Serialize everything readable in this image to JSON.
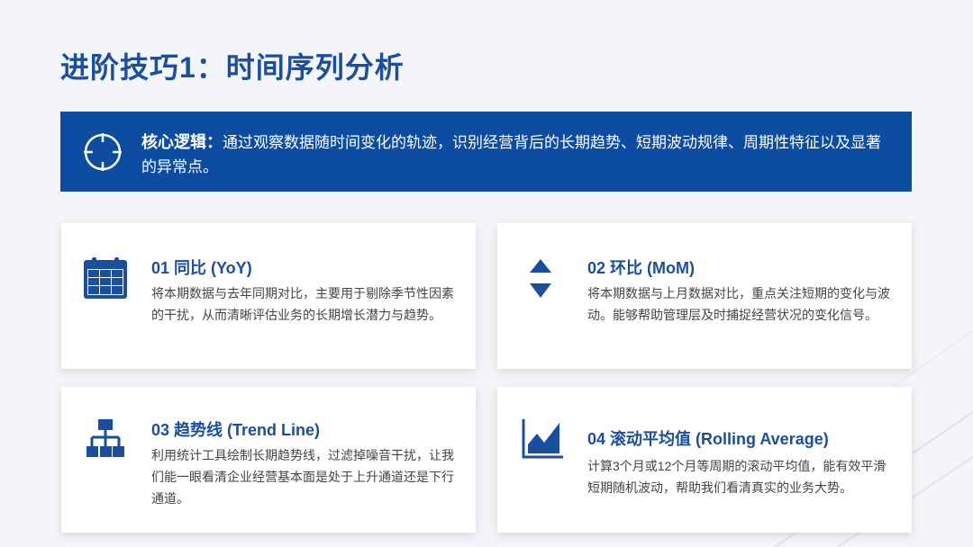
{
  "slide": {
    "title": "进阶技巧1：时间序列分析",
    "banner": {
      "label": "核心逻辑：",
      "text": "通过观察数据随时间变化的轨迹，识别经营背后的长期趋势、短期波动规律、周期性特征以及显著的异常点。"
    },
    "cards": [
      {
        "title": "01 同比 (YoY)",
        "desc": "将本期数据与去年同期对比，主要用于剔除季节性因素的干扰，从而清晰评估业务的长期增长潜力与趋势。",
        "icon": "calendar-icon"
      },
      {
        "title": "02 环比 (MoM)",
        "desc": "将本期数据与上月数据对比，重点关注短期的变化与波动。能够帮助管理层及时捕捉经营状况的变化信号。",
        "icon": "up-down-arrows-icon"
      },
      {
        "title": "03 趋势线 (Trend Line)",
        "desc": "利用统计工具绘制长期趋势线，过滤掉噪音干扰，让我们能一眼看清企业经营基本面是处于上升通道还是下行通道。",
        "icon": "hierarchy-icon"
      },
      {
        "title": "04 滚动平均值 (Rolling Average)",
        "desc": "计算3个月或12个月等周期的滚动平均值，能有效平滑短期随机波动，帮助我们看清真实的业务大势。",
        "icon": "area-chart-icon"
      }
    ],
    "colors": {
      "primary": "#1a4fa0",
      "banner_bg": "#0d4da1",
      "background": "#f4f5f8"
    }
  }
}
